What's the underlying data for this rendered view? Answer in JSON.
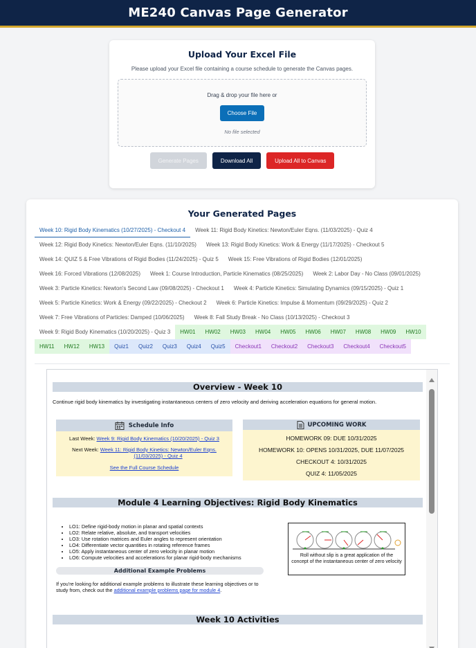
{
  "app": {
    "title": "ME240 Canvas Page Generator"
  },
  "upload": {
    "heading": "Upload Your Excel File",
    "description": "Please upload your Excel file containing a course schedule to generate the Canvas pages.",
    "drop_text": "Drag & drop your file here or",
    "choose_label": "Choose File",
    "file_status": "No file selected",
    "generate_label": "Generate Pages",
    "download_label": "Download All",
    "upload_canvas_label": "Upload All to Canvas"
  },
  "generated": {
    "heading": "Your Generated Pages",
    "tabs": [
      {
        "label": "Week 10: Rigid Body Kinematics (10/27/2025) - Checkout 4",
        "kind": "week",
        "active": true
      },
      {
        "label": "Week 11: Rigid Body Kinetics: Newton/Euler Eqns. (11/03/2025) - Quiz 4",
        "kind": "week"
      },
      {
        "label": "Week 12: Rigid Body Kinetics: Newton/Euler Eqns. (11/10/2025)",
        "kind": "week"
      },
      {
        "label": "Week 13: Rigid Body Kinetics: Work & Energy (11/17/2025) - Checkout 5",
        "kind": "week"
      },
      {
        "label": "Week 14: QUIZ 5 & Free Vibrations of Rigid Bodies (11/24/2025) - Quiz 5",
        "kind": "week"
      },
      {
        "label": "Week 15: Free Vibrations of Rigid Bodies (12/01/2025)",
        "kind": "week"
      },
      {
        "label": "Week 16: Forced Vibrations (12/08/2025)",
        "kind": "week"
      },
      {
        "label": "Week 1: Course Introduction, Particle Kinematics (08/25/2025)",
        "kind": "week"
      },
      {
        "label": "Week 2: Labor Day - No Class (09/01/2025)",
        "kind": "week"
      },
      {
        "label": "Week 3: Particle Kinetics: Newton's Second Law (09/08/2025) - Checkout 1",
        "kind": "week"
      },
      {
        "label": "Week 4: Particle Kinetics: Simulating Dynamics (09/15/2025) - Quiz 1",
        "kind": "week"
      },
      {
        "label": "Week 5: Particle Kinetics: Work & Energy (09/22/2025) - Checkout 2",
        "kind": "week"
      },
      {
        "label": "Week 6: Particle Kinetics: Impulse & Momentum (09/29/2025) - Quiz 2",
        "kind": "week"
      },
      {
        "label": "Week 7: Free Vibrations of Particles: Damped (10/06/2025)",
        "kind": "week"
      },
      {
        "label": "Week 8: Fall Study Break - No Class (10/13/2025) - Checkout 3",
        "kind": "week"
      },
      {
        "label": "Week 9: Rigid Body Kinematics (10/20/2025) - Quiz 3",
        "kind": "week"
      },
      {
        "label": "HW01",
        "kind": "hw"
      },
      {
        "label": "HW02",
        "kind": "hw"
      },
      {
        "label": "HW03",
        "kind": "hw"
      },
      {
        "label": "HW04",
        "kind": "hw"
      },
      {
        "label": "HW05",
        "kind": "hw"
      },
      {
        "label": "HW06",
        "kind": "hw"
      },
      {
        "label": "HW07",
        "kind": "hw"
      },
      {
        "label": "HW08",
        "kind": "hw"
      },
      {
        "label": "HW09",
        "kind": "hw"
      },
      {
        "label": "HW10",
        "kind": "hw"
      },
      {
        "label": "HW11",
        "kind": "hw"
      },
      {
        "label": "HW12",
        "kind": "hw"
      },
      {
        "label": "HW13",
        "kind": "hw"
      },
      {
        "label": "Quiz1",
        "kind": "quiz"
      },
      {
        "label": "Quiz2",
        "kind": "quiz"
      },
      {
        "label": "Quiz3",
        "kind": "quiz"
      },
      {
        "label": "Quiz4",
        "kind": "quiz"
      },
      {
        "label": "Quiz5",
        "kind": "quiz"
      },
      {
        "label": "Checkout1",
        "kind": "ck"
      },
      {
        "label": "Checkout2",
        "kind": "ck"
      },
      {
        "label": "Checkout3",
        "kind": "ck"
      },
      {
        "label": "Checkout4",
        "kind": "ck"
      },
      {
        "label": "Checkout5",
        "kind": "ck"
      }
    ]
  },
  "preview": {
    "overview_title": "Overview - Week 10",
    "overview_text": "Continue rigid body kinematics by investigating instantaneous centers of zero velocity and deriving acceleration equations for general motion.",
    "schedule": {
      "title": "Schedule Info",
      "last_week_label": "Last Week:",
      "last_week_link": "Week 9: Rigid Body Kinematics (10/20/2025) - Quiz 3",
      "next_week_label": "Next Week:",
      "next_week_link_1": "Week 11: Rigid Body Kinetics: Newton/Euler Eqns.",
      "next_week_link_2": "(11/03/2025) - Quiz 4",
      "full_schedule": "See the Full Course Schedule"
    },
    "upcoming": {
      "title": "UPCOMING WORK",
      "items": [
        "HOMEWORK 09: DUE 10/31/2025",
        "HOMEWORK 10: OPENS 10/31/2025, DUE 11/07/2025",
        "CHECKOUT 4: 10/31/2025",
        "QUIZ 4: 11/05/2025"
      ]
    },
    "module_title": "Module 4 Learning Objectives: Rigid Body Kinematics",
    "objectives": [
      "LO1: Define rigid-body motion in planar and spatial contexts",
      "LO2: Relate relative, absolute, and transport velocities",
      "LO3: Use rotation matrices and Euler angles to represent orientation",
      "LO4: Differentiate vector quantities in rotating reference frames",
      "LO5: Apply instantaneous center of zero velocity in planar motion",
      "LO6: Compute velocities and accelerations for planar rigid-body mechanisms"
    ],
    "additional_title": "Additional Example Problems",
    "additional_text_1": "If you're looking for additional example problems to illustrate these learning objectives or to study from, check out the",
    "additional_link": "additional example problems page for module 4",
    "additional_text_2": ".",
    "figure_caption": "Roll without slip is a great application of the concept of the instantaneous center of zero velocity",
    "activities_title": "Week 10 Activities"
  },
  "colors": {
    "navy": "#0f2447",
    "gold": "#d4a72c",
    "blue_button": "#0b6fb8",
    "red_button": "#dc2626"
  }
}
